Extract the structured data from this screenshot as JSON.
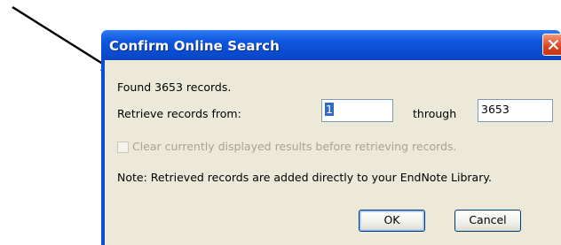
{
  "dialog": {
    "title": "Confirm Online Search",
    "found_text": "Found 3653 records.",
    "retrieve_label": "Retrieve records from:",
    "from_value": "1",
    "through_label": "through",
    "through_value": "3653",
    "clear_checkbox_label": "Clear currently displayed results before retrieving records.",
    "clear_checkbox_checked": false,
    "note_text": "Note: Retrieved records are added directly to your EndNote Library.",
    "ok_label": "OK",
    "cancel_label": "Cancel"
  },
  "colors": {
    "titlebar": "#0a4fd6",
    "client_bg": "#ece9d8",
    "close_button": "#d9431f"
  }
}
